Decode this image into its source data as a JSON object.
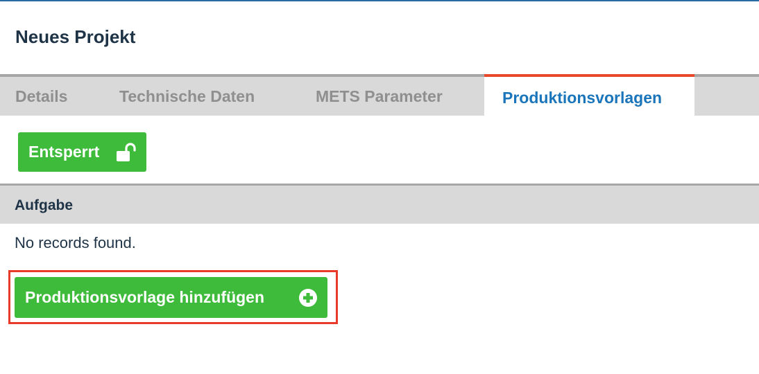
{
  "page": {
    "title": "Neues Projekt"
  },
  "tabs": [
    {
      "label": "Details",
      "active": false
    },
    {
      "label": "Technische Daten",
      "active": false
    },
    {
      "label": "METS Parameter",
      "active": false
    },
    {
      "label": "Produktionsvorlagen",
      "active": true
    }
  ],
  "lock_button": {
    "label": "Entsperrt",
    "icon": "unlocked-icon"
  },
  "table": {
    "column_header": "Aufgabe",
    "empty_message": "No records found."
  },
  "add_button": {
    "label": "Produktionsvorlage hinzufügen",
    "icon": "plus-circle-icon"
  },
  "colors": {
    "accent_blue": "#1b75bb",
    "active_tab_border": "#e8492a",
    "button_green": "#3ebb3a",
    "highlight_red": "#e8392a"
  }
}
